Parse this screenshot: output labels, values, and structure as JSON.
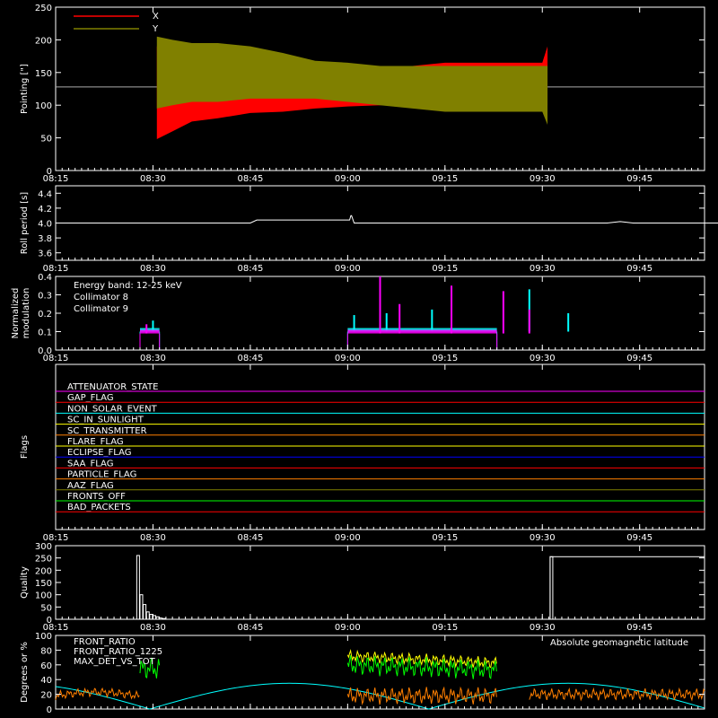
{
  "time_axis": {
    "start_min": 495,
    "end_min": 1315,
    "tick_minutes": [
      495,
      510,
      525,
      540,
      555,
      570,
      585
    ],
    "tick_labels": [
      "08:15",
      "08:30",
      "08:45",
      "09:00",
      "09:15",
      "09:30",
      "09:45"
    ]
  },
  "chart_data": [
    {
      "id": "pointing",
      "type": "area",
      "ylabel": "Pointing [\"]",
      "ylim": [
        0,
        250
      ],
      "yticks": [
        0,
        50,
        100,
        150,
        200,
        250
      ],
      "legend": [
        "X",
        "Y"
      ],
      "colors": {
        "X": "#ff0000",
        "Y": "#808000"
      },
      "reference_line": 128,
      "series": [
        {
          "name": "X",
          "t": [
            510.6,
            513,
            516,
            520,
            525,
            530,
            535,
            540,
            545,
            550,
            555,
            560,
            565,
            570,
            570.8
          ],
          "low": [
            48,
            60,
            75,
            80,
            88,
            90,
            95,
            98,
            100,
            100,
            100,
            100,
            100,
            100,
            100
          ],
          "high": [
            190,
            195,
            150,
            145,
            140,
            145,
            150,
            152,
            160,
            160,
            165,
            165,
            165,
            165,
            190
          ]
        },
        {
          "name": "Y",
          "t": [
            510.6,
            513,
            516,
            520,
            525,
            530,
            535,
            540,
            545,
            550,
            555,
            560,
            565,
            570,
            570.8
          ],
          "low": [
            95,
            100,
            105,
            105,
            110,
            110,
            110,
            105,
            100,
            95,
            90,
            90,
            90,
            90,
            70
          ],
          "high": [
            205,
            200,
            195,
            195,
            190,
            180,
            168,
            165,
            160,
            160,
            160,
            160,
            160,
            160,
            160
          ]
        }
      ]
    },
    {
      "id": "roll",
      "type": "line",
      "ylabel": "Roll period [s]",
      "ylim": [
        3.5,
        4.5
      ],
      "yticks": [
        3.6,
        3.8,
        4.0,
        4.2,
        4.4
      ],
      "series": [
        {
          "name": "",
          "x": [
            495,
            512,
            513,
            525,
            526,
            540.3,
            540.5,
            540.6,
            541,
            561.3,
            580,
            582,
            584,
            586,
            610
          ],
          "y": [
            4.0,
            4.0,
            4.0,
            4.0,
            4.04,
            4.04,
            4.1,
            4.1,
            4.0,
            4.0,
            4.0,
            4.02,
            4.0,
            4.0,
            4.0
          ]
        }
      ]
    },
    {
      "id": "modulation",
      "type": "line",
      "ylabel": "Normalized modulation",
      "ylim": [
        0,
        0.4
      ],
      "yticks": [
        0.0,
        0.1,
        0.2,
        0.3,
        0.4
      ],
      "annotation": "Energy band: 12-25 keV",
      "legend": [
        "Collimator 8",
        "Collimator 9"
      ],
      "colors": {
        "Collimator 8": "#00ffff",
        "Collimator 9": "#ff00ff"
      },
      "series": [
        {
          "name": "Collimator 8",
          "segments": [
            [
              508,
              511
            ],
            [
              540,
              563
            ]
          ],
          "base": 0.1,
          "spikes": [
            [
              510,
              0.16
            ],
            [
              541,
              0.19
            ],
            [
              546,
              0.2
            ],
            [
              553,
              0.22
            ],
            [
              568,
              0.33
            ],
            [
              574,
              0.2
            ]
          ]
        },
        {
          "name": "Collimator 9",
          "segments": [
            [
              508,
              511
            ],
            [
              540,
              563
            ]
          ],
          "base": 0.09,
          "spikes": [
            [
              509,
              0.14
            ],
            [
              545,
              0.4
            ],
            [
              548,
              0.25
            ],
            [
              556,
              0.35
            ],
            [
              564,
              0.32
            ],
            [
              568,
              0.22
            ]
          ]
        }
      ]
    },
    {
      "id": "flags",
      "type": "table",
      "ylabel": "Flags",
      "rows": [
        {
          "label": "ATTENUATOR_STATE",
          "color": "#ff00ff"
        },
        {
          "label": "GAP_FLAG",
          "color": "#ff0000"
        },
        {
          "label": "NON_SOLAR_EVENT",
          "color": "#00ffff"
        },
        {
          "label": "SC_IN_SUNLIGHT",
          "color": "#ffff00"
        },
        {
          "label": "SC_TRANSMITTER",
          "color": "#ff7f00"
        },
        {
          "label": "FLARE_FLAG",
          "color": "#ffff00"
        },
        {
          "label": "ECLIPSE_FLAG",
          "color": "#0000ff"
        },
        {
          "label": "SAA_FLAG",
          "color": "#ff0000"
        },
        {
          "label": "PARTICLE_FLAG",
          "color": "#ff7f00"
        },
        {
          "label": "AAZ_FLAG",
          "color": "#808000"
        },
        {
          "label": "FRONTS_OFF",
          "color": "#00ff00"
        },
        {
          "label": "BAD_PACKETS",
          "color": "#ff0000"
        }
      ]
    },
    {
      "id": "quality",
      "type": "bar",
      "ylabel": "Quality",
      "ylim": [
        0,
        300
      ],
      "yticks": [
        0,
        50,
        100,
        150,
        200,
        250,
        300
      ],
      "series": [
        {
          "name": "",
          "x": [
            507.5,
            508.0,
            508.5,
            509.0,
            509.5,
            510.0,
            510.5,
            511.0,
            511.5,
            512.0,
            571.2,
            580
          ],
          "y": [
            260,
            100,
            60,
            30,
            20,
            15,
            10,
            5,
            3,
            0,
            255,
            255
          ]
        }
      ]
    },
    {
      "id": "fronts",
      "type": "line",
      "ylabel": "Degrees or %",
      "ylim": [
        0,
        100
      ],
      "yticks": [
        0,
        20,
        40,
        60,
        80,
        100
      ],
      "legend": [
        "FRONT_RATIO",
        "FRONT_RATIO_1225",
        "MAX_DET_VS_TOT"
      ],
      "annotation": "Absolute geomagnetic latitude",
      "colors": {
        "FRONT_RATIO": "#ffff00",
        "FRONT_RATIO_1225": "#00ff00",
        "MAX_DET_VS_TOT": "#ff7f00",
        "Absolute geomagnetic latitude": "#00ffff"
      }
    }
  ]
}
